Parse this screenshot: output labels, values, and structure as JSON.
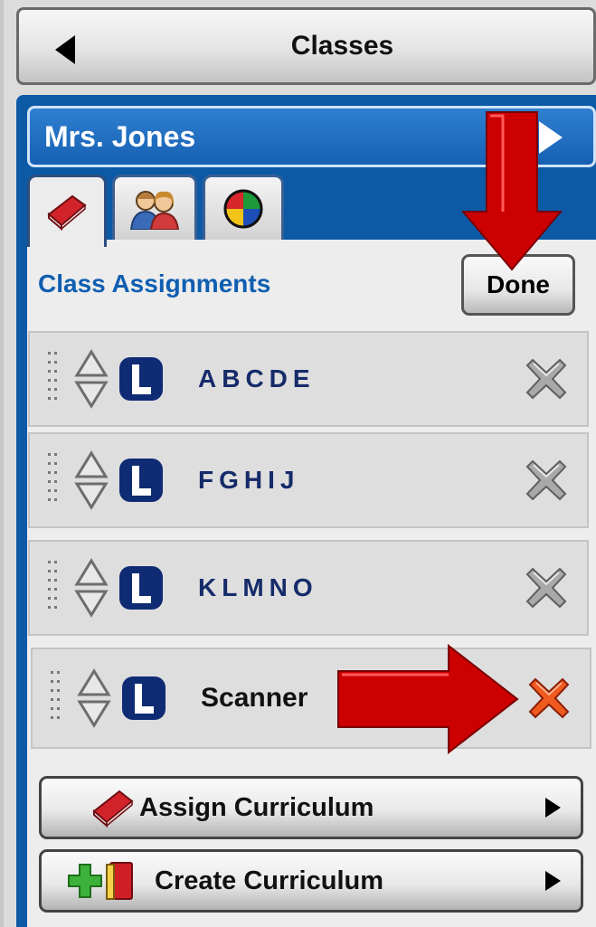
{
  "header": {
    "back_title": "Classes"
  },
  "teacher": {
    "name": "Mrs. Jones"
  },
  "tabs": [
    {
      "icon": "book-icon",
      "active": true
    },
    {
      "icon": "students-icon",
      "active": false
    },
    {
      "icon": "pie-chart-icon",
      "active": false
    }
  ],
  "section": {
    "title": "Class Assignments",
    "done_label": "Done"
  },
  "assignments": [
    {
      "label": "ABCDE"
    },
    {
      "label": "FGHIJ"
    },
    {
      "label": "KLMNO"
    },
    {
      "label": "Scanner"
    }
  ],
  "actions": {
    "assign_label": "Assign Curriculum",
    "create_label": "Create Curriculum"
  },
  "colors": {
    "panel_blue": "#0c5aa6",
    "title_blue": "#0f5eb0",
    "arrow_red": "#cc0000",
    "delete_active": "#e04a1c"
  }
}
